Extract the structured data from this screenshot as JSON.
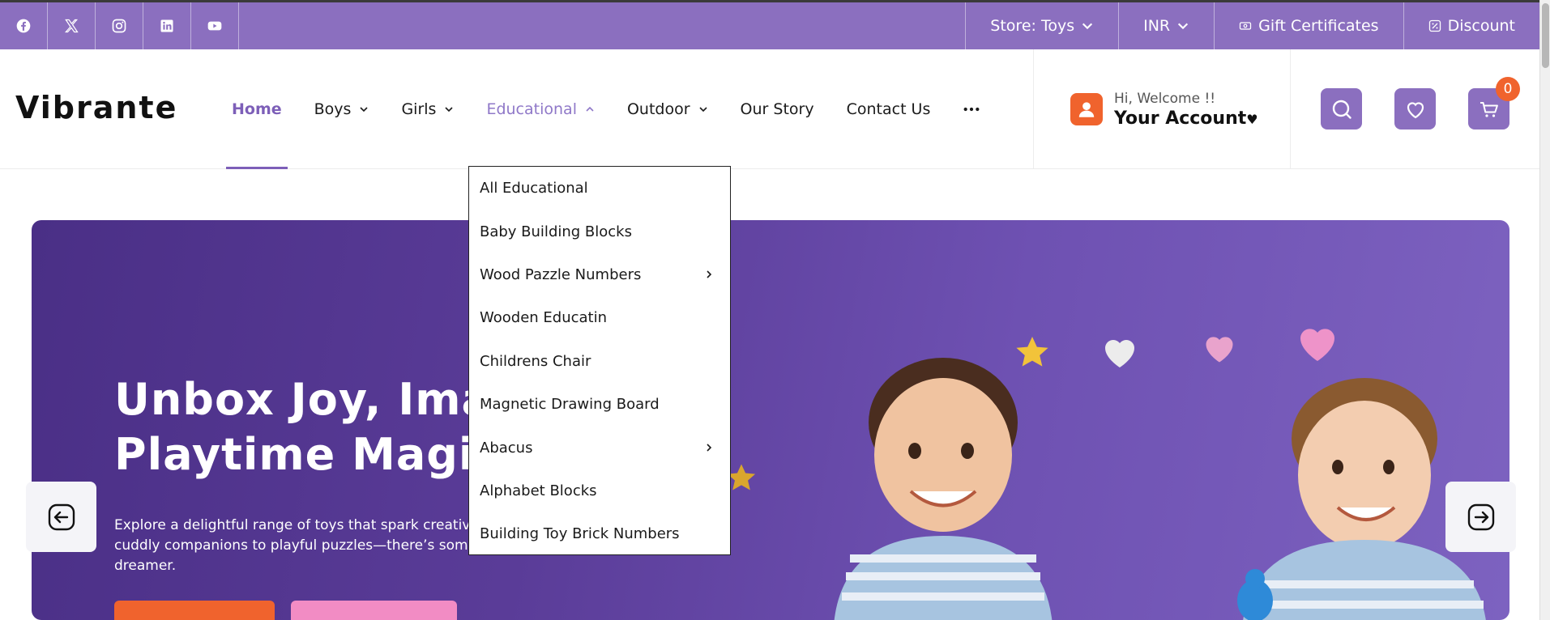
{
  "topbar": {
    "social": [
      "facebook-icon",
      "x-icon",
      "instagram-icon",
      "linkedin-icon",
      "youtube-icon"
    ],
    "store_label": "Store: Toys",
    "currency_label": "INR",
    "gift_label": "Gift Certificates",
    "discount_label": "Discount"
  },
  "header": {
    "logo": "Vibrante",
    "nav": [
      "Home",
      "Boys",
      "Girls",
      "Educational",
      "Outdoor",
      "Our Story",
      "Contact Us"
    ],
    "greeting": "Hi, Welcome !!",
    "account": "Your Account",
    "cart_count": "0"
  },
  "dropdown": {
    "items": [
      {
        "label": "All Educational",
        "has_sub": false
      },
      {
        "label": "Baby Building Blocks",
        "has_sub": false
      },
      {
        "label": "Wood Pazzle Numbers",
        "has_sub": true
      },
      {
        "label": "Wooden Educatin",
        "has_sub": false
      },
      {
        "label": "Childrens Chair",
        "has_sub": false
      },
      {
        "label": "Magnetic Drawing Board",
        "has_sub": false
      },
      {
        "label": "Abacus",
        "has_sub": true
      },
      {
        "label": "Alphabet Blocks",
        "has_sub": false
      },
      {
        "label": "Building Toy Brick Numbers",
        "has_sub": false
      }
    ]
  },
  "hero": {
    "title_line1": "Unbox Joy, Imagin",
    "title_line2": "Playtime Magic!",
    "desc_line1": "Explore a delightful range of toys that spark creativity,",
    "desc_line2": "cuddly companions to playful puzzles—there’s someth",
    "desc_line3": "dreamer."
  },
  "colors": {
    "brand_purple": "#8b6fbf",
    "accent_orange": "#f0632d",
    "accent_pink": "#f28cc4"
  }
}
